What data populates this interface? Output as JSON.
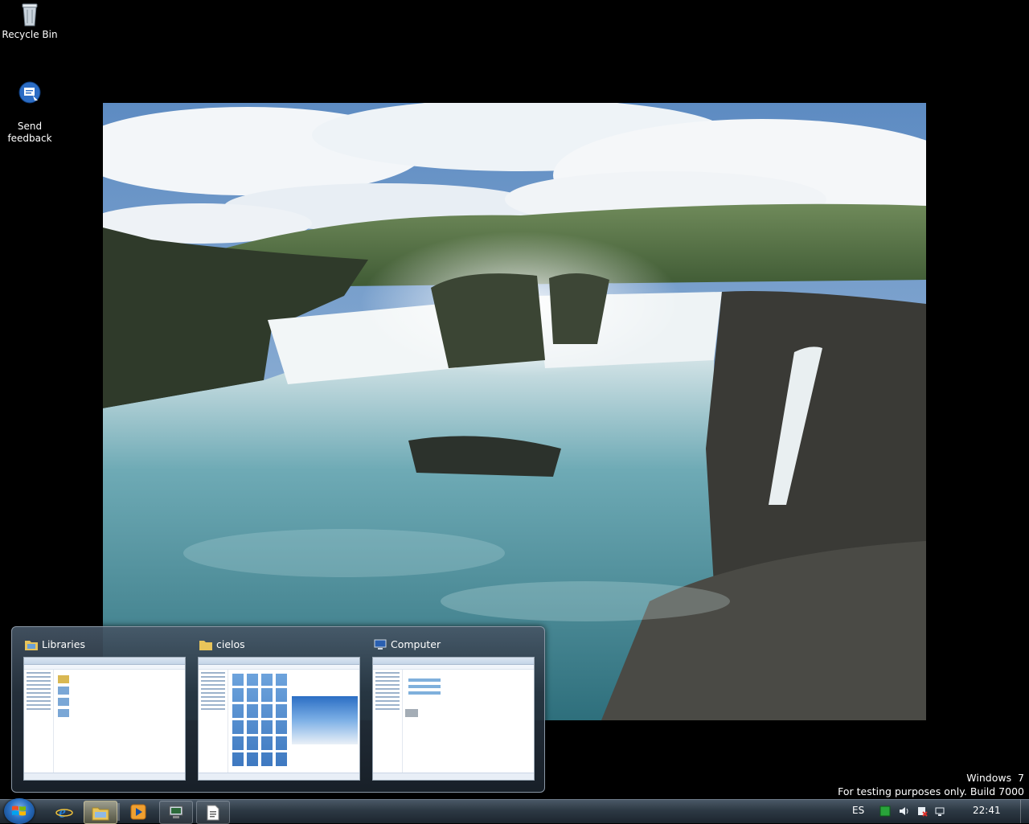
{
  "desktop": {
    "icons": [
      {
        "label": "Recycle Bin"
      },
      {
        "label": "Send\nfeedback"
      }
    ]
  },
  "flyout": {
    "thumbnails": [
      {
        "title": "Libraries",
        "icon": "library-folder-icon"
      },
      {
        "title": "cielos",
        "icon": "folder-icon"
      },
      {
        "title": "Computer",
        "icon": "computer-icon"
      }
    ]
  },
  "taskbar": {
    "apps": [
      {
        "name": "internet-explorer",
        "icon": "ie-icon"
      },
      {
        "name": "windows-explorer",
        "icon": "explorer-icon",
        "state": "active"
      },
      {
        "name": "media-player",
        "icon": "media-player-icon"
      },
      {
        "name": "remote-desktop",
        "icon": "remote-desktop-icon"
      },
      {
        "name": "document",
        "icon": "document-icon"
      }
    ],
    "language": "ES",
    "clock": "22:41"
  },
  "watermark": {
    "line1": "Windows  7",
    "line2": "For testing purposes only. Build 7000"
  }
}
